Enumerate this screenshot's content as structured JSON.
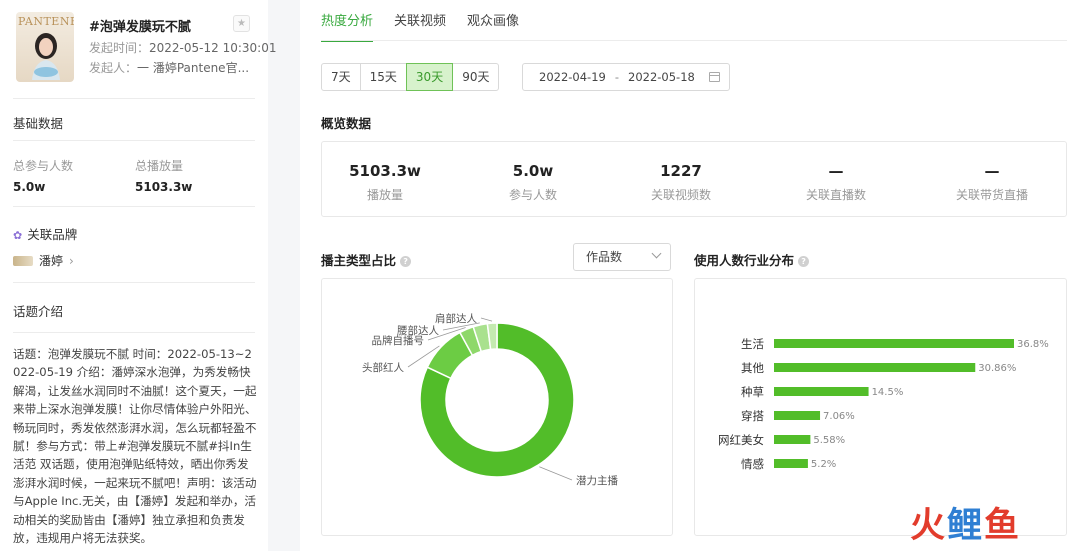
{
  "topic": {
    "thumb_brand": "PANTENE",
    "title": "#泡弹发膜玩不腻",
    "start_label": "发起时间：",
    "start_time": "2022-05-12 10:30:01",
    "initiator_label": "发起人：",
    "initiator": "一 潘婷Pantene官..."
  },
  "basic": {
    "title": "基础数据",
    "participants_label": "总参与人数",
    "participants": "5.0w",
    "plays_label": "总播放量",
    "plays": "5103.3w"
  },
  "brand": {
    "title": "关联品牌",
    "name": "潘婷"
  },
  "intro": {
    "title": "话题介绍",
    "text": "话题：泡弹发膜玩不腻 时间：2022-05-13~2022-05-19 介绍：潘婷深水泡弹，为秀发畅快解渴，让发丝水润同时不油腻！这个夏天，一起来带上深水泡弹发膜！让你尽情体验户外阳光、畅玩同时，秀发依然澎湃水润，怎么玩都轻盈不腻！参与方式：带上#泡弹发膜玩不腻#抖In生活范 双话题，使用泡弹贴纸特效，晒出你秀发澎湃水润时候，一起来玩不腻吧！声明：该活动与Apple Inc.无关，由【潘婷】发起和举办，活动相关的奖励皆由【潘婷】独立承担和负责发放，违规用户将无法获奖。"
  },
  "tabs": [
    "热度分析",
    "关联视频",
    "观众画像"
  ],
  "ranges": [
    "7天",
    "15天",
    "30天",
    "90天"
  ],
  "active_range": "30天",
  "date_range": {
    "start": "2022-04-19",
    "sep": "-",
    "end": "2022-05-18"
  },
  "overview": {
    "title": "概览数据",
    "items": [
      {
        "value": "5103.3w",
        "label": "播放量"
      },
      {
        "value": "5.0w",
        "label": "参与人数"
      },
      {
        "value": "1227",
        "label": "关联视频数"
      },
      {
        "value": "—",
        "label": "关联直播数"
      },
      {
        "value": "—",
        "label": "关联带货直播"
      }
    ]
  },
  "donut_section": {
    "title": "播主类型占比",
    "dropdown": "作品数"
  },
  "bar_section": {
    "title": "使用人数行业分布"
  },
  "chart_data": [
    {
      "type": "pie",
      "categories": [
        "潜力主播",
        "头部红人",
        "品牌自播号",
        "腰部达人",
        "肩部达人"
      ],
      "values": [
        82,
        10,
        3,
        3,
        2
      ],
      "colors": [
        "#52bd29",
        "#6ccc44",
        "#8ed86a",
        "#a9e18e",
        "#c4eab0"
      ]
    },
    {
      "type": "bar",
      "categories": [
        "生活",
        "其他",
        "种草",
        "穿搭",
        "网红美女",
        "情感"
      ],
      "values": [
        36.8,
        30.86,
        14.5,
        7.06,
        5.58,
        5.2
      ],
      "labels": [
        "36.8%",
        "30.86%",
        "14.5%",
        "7.06%",
        "5.58%",
        "5.2%"
      ],
      "color": "#52bd29"
    }
  ],
  "watermark": {
    "part1": "火",
    "part2": "鲤",
    "part3": "鱼"
  }
}
